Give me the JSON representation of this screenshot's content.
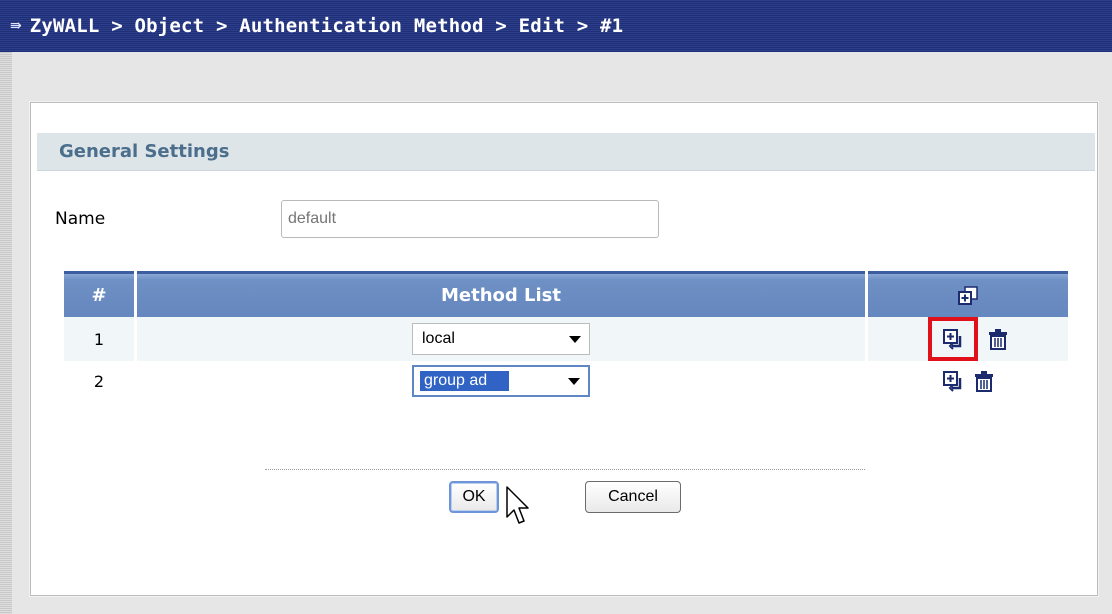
{
  "breadcrumb": "ZyWALL > Object > Authentication Method > Edit > #1",
  "section_title": "General Settings",
  "name_label": "Name",
  "name_placeholder": "default",
  "table": {
    "headers": {
      "num": "#",
      "method": "Method List"
    },
    "rows": [
      {
        "num": "1",
        "method": "local"
      },
      {
        "num": "2",
        "method": "group ad"
      }
    ]
  },
  "buttons": {
    "ok": "OK",
    "cancel": "Cancel"
  },
  "icons": [
    "add-after-icon",
    "trash-icon",
    "cursor-pointer-icon"
  ],
  "colors": {
    "title_bar": "#1f2f75",
    "header_blue": "#6587bf",
    "highlight_red": "#e0111b",
    "section_text": "#4b6e8c"
  }
}
